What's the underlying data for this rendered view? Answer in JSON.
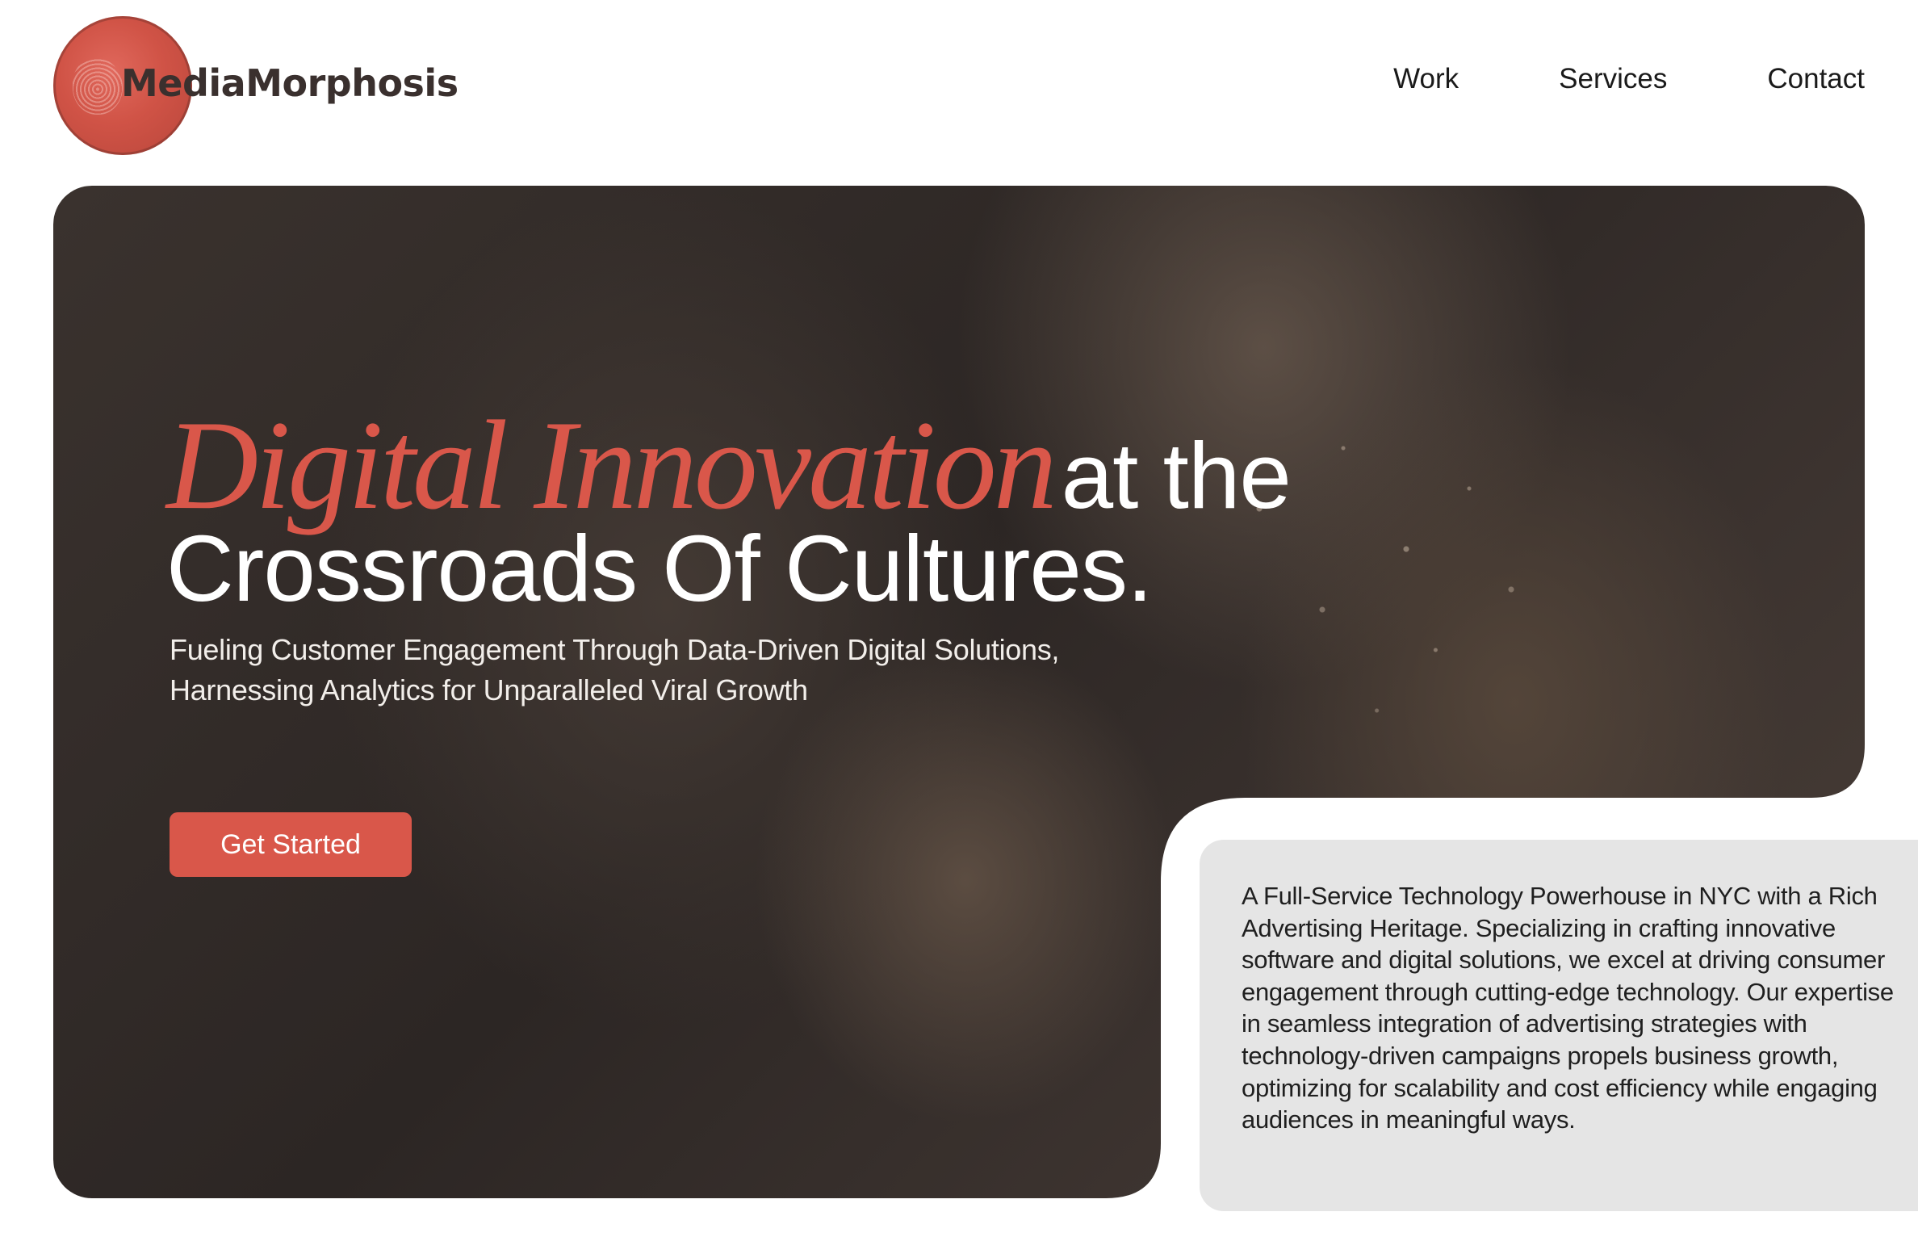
{
  "brand": {
    "name": "MediaMorphosis",
    "accent_color": "#d9574a",
    "logo_icon": "fingerprint-circle-icon"
  },
  "nav": {
    "items": [
      {
        "label": "Work"
      },
      {
        "label": "Services"
      },
      {
        "label": "Contact"
      }
    ]
  },
  "hero": {
    "headline_accent": "Digital Innovation",
    "headline_rest": "at the",
    "headline_line2": "Crossroads Of Cultures.",
    "subheadline": "Fueling Customer Engagement Through Data-Driven Digital Solutions, Harnessing Analytics for Unparalleled Viral Growth",
    "cta_label": "Get Started"
  },
  "info": {
    "text": "A Full-Service Technology Powerhouse in NYC with a Rich Advertising Heritage. Specializing in crafting innovative software and digital solutions, we excel at driving consumer engagement through cutting-edge technology. Our expertise in seamless integration of advertising strategies with technology-driven campaigns propels business growth, optimizing for scalability and cost efficiency while engaging audiences in meaningful ways."
  }
}
